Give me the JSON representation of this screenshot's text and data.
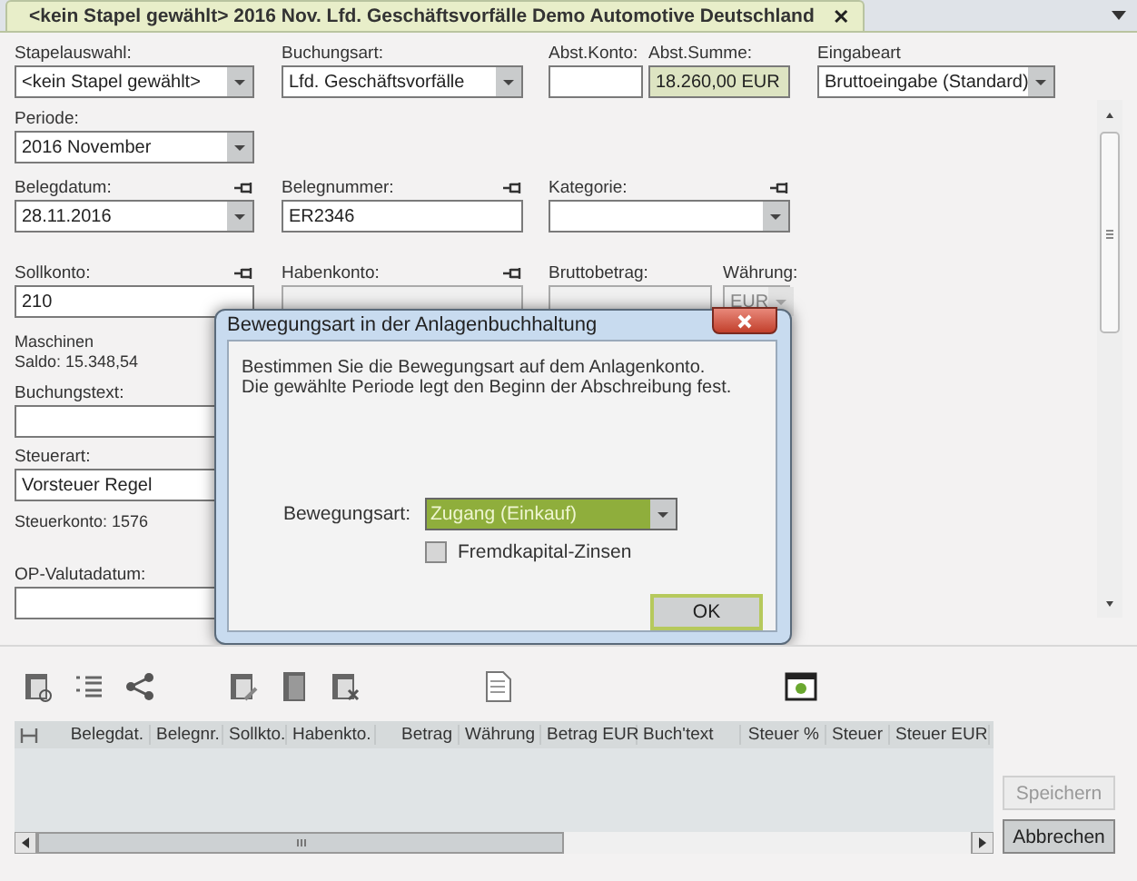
{
  "tab": {
    "title": "<kein Stapel gewählt> 2016 Nov. Lfd. Geschäftsvorfälle Demo Automotive Deutschland",
    "close": "✕",
    "selected": true
  },
  "form_rows": [
    [
      {
        "label": "Stapelauswahl:",
        "value": "<kein Stapel gewählt>",
        "kind": "dropdown",
        "pinned": false,
        "disabled": false
      },
      {
        "label": "Buchungsart:",
        "value": "Lfd. Geschäftsvorfälle",
        "kind": "dropdown",
        "pinned": false,
        "disabled": false
      },
      {
        "label": "Abst.Konto:",
        "kind": "input",
        "pinned": false,
        "disabled": false
      },
      {
        "label": "Abst.Summe:",
        "value": "18.260,00 EUR",
        "kind": "total",
        "pinned": false,
        "disabled": false
      },
      {
        "label": "Eingabeart",
        "value": "Bruttoeingabe (Standard)",
        "kind": "dropdown",
        "pinned": false,
        "disabled": false
      }
    ],
    [
      {
        "label": "Periode:",
        "value": "2016  November",
        "kind": "dropdown",
        "pinned": false,
        "disabled": false
      }
    ],
    [
      {
        "label": "Belegdatum:",
        "value": "28.11.2016",
        "kind": "dropdown",
        "pinned": true,
        "disabled": false
      },
      {
        "label": "Belegnummer:",
        "value": "ER2346",
        "kind": "input",
        "pinned": true,
        "disabled": false
      },
      {
        "label": "Kategorie:",
        "kind": "dropdown",
        "pinned": true,
        "disabled": false
      }
    ],
    [
      {
        "label": "Sollkonto:",
        "value": "210",
        "kind": "input",
        "pinned": true,
        "disabled": false
      },
      {
        "label": "Habenkonto:",
        "kind": "input",
        "pinned": true,
        "disabled": true
      },
      {
        "label": "Bruttobetrag:",
        "kind": "input",
        "pinned": false,
        "disabled": true
      },
      {
        "label": "Währung:",
        "value": "EUR",
        "kind": "dropdown",
        "pinned": false,
        "disabled": true
      }
    ]
  ],
  "lower_items": [
    {
      "kind": "note",
      "text": "Maschinen"
    },
    {
      "kind": "note",
      "text": "Saldo: 15.348,54"
    },
    {
      "kind": "field",
      "label": "Buchungstext:"
    },
    {
      "kind": "field",
      "label": "Steuerart:",
      "value": "Vorsteuer Regel"
    },
    {
      "kind": "note",
      "text": "Steuerkonto: 1576"
    },
    {
      "kind": "field",
      "label": "OP-Valutadatum:"
    }
  ],
  "table": {
    "columns": [
      "Belegdat.",
      "Belegnr.",
      "Sollkto.",
      "Habenkto.",
      "Betrag",
      "Währung",
      "Betrag EUR",
      "Buch'text",
      "Steuer %",
      "Steuer",
      "Steuer EUR"
    ]
  },
  "buttons": [
    {
      "label": "Speichern",
      "disabled": true
    },
    {
      "label": "Abbrechen",
      "disabled": false
    }
  ],
  "dialog": {
    "title": "Bewegungsart in der Anlagenbuchhaltung",
    "lines": [
      "Bestimmen Sie die Bewegungsart auf dem Anlagenkonto.",
      "Die gewählte Periode legt den Beginn der Abschreibung fest."
    ],
    "field_label": "Bewegungsart:",
    "field_value": "Zugang (Einkauf)",
    "checkbox": {
      "label": "Fremdkapital-Zinsen",
      "checked": false
    },
    "ok": "OK"
  }
}
